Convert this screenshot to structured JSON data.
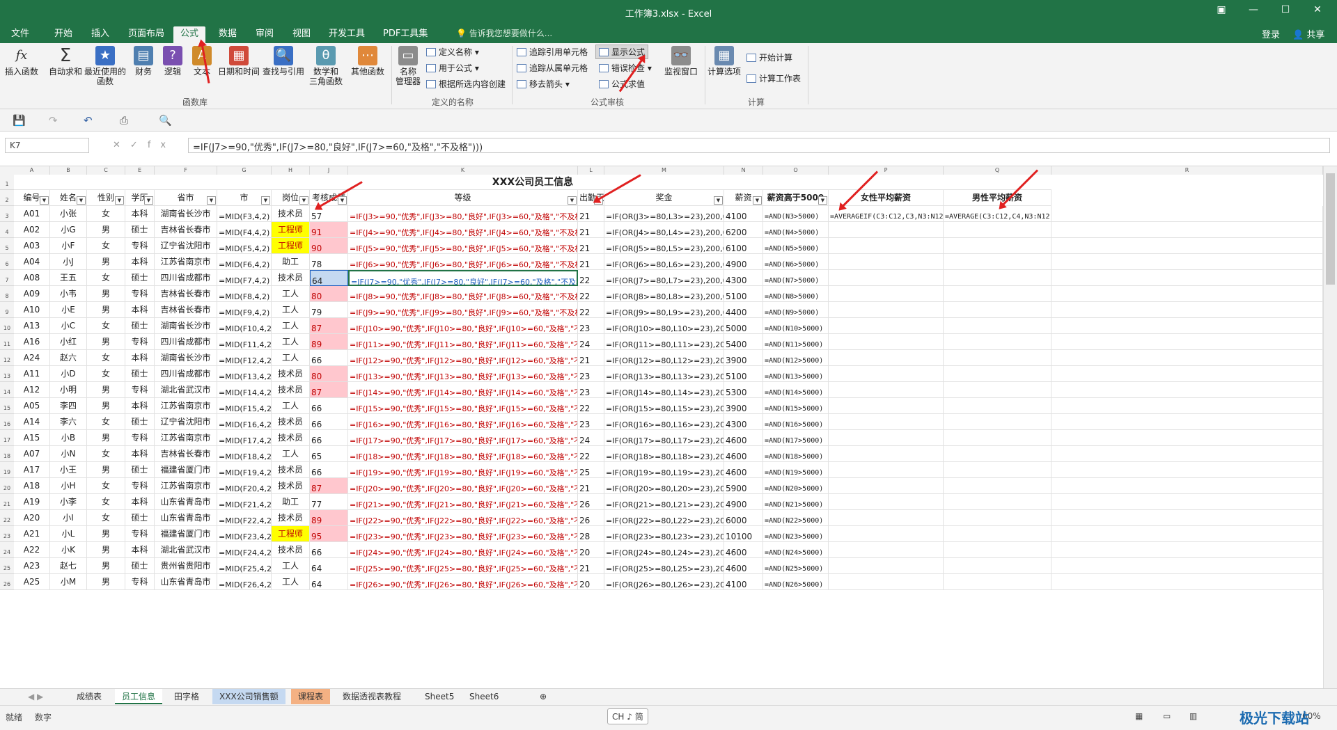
{
  "window": {
    "title": "工作簿3.xlsx - Excel"
  },
  "tabs": [
    "文件",
    "开始",
    "插入",
    "页面布局",
    "公式",
    "数据",
    "审阅",
    "视图",
    "开发工具",
    "PDF工具集"
  ],
  "tellme": "告诉我您想要做什么...",
  "account": {
    "login": "登录",
    "share": "共享"
  },
  "ribbon": {
    "func_lib": [
      "插入函数",
      "自动求和",
      "最近使用的\n函数",
      "财务",
      "逻辑",
      "文本",
      "日期和时间",
      "查找与引用",
      "数学和\n三角函数",
      "其他函数"
    ],
    "func_lib_label": "函数库",
    "names": {
      "manager": "名称\n管理器",
      "define": "定义名称",
      "use": "用于公式",
      "create": "根据所选内容创建",
      "label": "定义的名称"
    },
    "audit": {
      "trace_prec": "追踪引用单元格",
      "trace_dep": "追踪从属单元格",
      "remove": "移去箭头",
      "show": "显示公式",
      "check": "错误检查",
      "eval": "公式求值",
      "watch": "监视窗口",
      "label": "公式审核"
    },
    "calc": {
      "options": "计算选项",
      "now": "开始计算",
      "sheet": "计算工作表",
      "label": "计算"
    }
  },
  "namebox": "K7",
  "formula": "=IF(J7>=90,\"优秀\",IF(J7>=80,\"良好\",IF(J7>=60,\"及格\",\"不及格\")))",
  "columns": [
    "A",
    "B",
    "C",
    "E",
    "F",
    "G",
    "H",
    "J",
    "K",
    "L",
    "M",
    "N",
    "O",
    "P",
    "Q",
    "R"
  ],
  "sheet_title": "XXX公司员工信息",
  "headers": [
    "编号",
    "姓名",
    "性别",
    "学历",
    "省市",
    "市",
    "岗位",
    "考核成绩",
    "等级",
    "出勤天",
    "奖金",
    "薪资",
    "薪资高于5000",
    "女性平均薪资",
    "男性平均薪资"
  ],
  "rows": [
    [
      "A01",
      "小张",
      "女",
      "本科",
      "湖南省长沙市",
      "技术员",
      "57",
      "21",
      "4100"
    ],
    [
      "A02",
      "小G",
      "男",
      "硕士",
      "吉林省长春市",
      "工程师",
      "91",
      "21",
      "6200"
    ],
    [
      "A03",
      "小F",
      "女",
      "专科",
      "辽宁省沈阳市",
      "工程师",
      "90",
      "21",
      "6100"
    ],
    [
      "A04",
      "小J",
      "男",
      "本科",
      "江苏省南京市",
      "助工",
      "78",
      "21",
      "4900"
    ],
    [
      "A08",
      "王五",
      "女",
      "硕士",
      "四川省成都市",
      "技术员",
      "64",
      "22",
      "4300"
    ],
    [
      "A09",
      "小韦",
      "男",
      "专科",
      "吉林省长春市",
      "工人",
      "80",
      "22",
      "5100"
    ],
    [
      "A10",
      "小E",
      "男",
      "本科",
      "吉林省长春市",
      "工人",
      "79",
      "22",
      "4400"
    ],
    [
      "A13",
      "小C",
      "女",
      "硕士",
      "湖南省长沙市",
      "工人",
      "87",
      "23",
      "5000"
    ],
    [
      "A16",
      "小红",
      "男",
      "专科",
      "四川省成都市",
      "工人",
      "89",
      "24",
      "5400"
    ],
    [
      "A24",
      "赵六",
      "女",
      "本科",
      "湖南省长沙市",
      "工人",
      "66",
      "21",
      "3900"
    ],
    [
      "A11",
      "小D",
      "女",
      "硕士",
      "四川省成都市",
      "技术员",
      "80",
      "23",
      "5100"
    ],
    [
      "A12",
      "小明",
      "男",
      "专科",
      "湖北省武汉市",
      "技术员",
      "87",
      "23",
      "5300"
    ],
    [
      "A05",
      "李四",
      "男",
      "本科",
      "江苏省南京市",
      "工人",
      "66",
      "22",
      "3900"
    ],
    [
      "A14",
      "李六",
      "女",
      "硕士",
      "辽宁省沈阳市",
      "技术员",
      "66",
      "23",
      "4300"
    ],
    [
      "A15",
      "小B",
      "男",
      "专科",
      "江苏省南京市",
      "技术员",
      "66",
      "24",
      "4600"
    ],
    [
      "A07",
      "小N",
      "女",
      "本科",
      "吉林省长春市",
      "工人",
      "65",
      "22",
      "4600"
    ],
    [
      "A17",
      "小王",
      "男",
      "硕士",
      "福建省厦门市",
      "技术员",
      "66",
      "25",
      "4600"
    ],
    [
      "A18",
      "小H",
      "女",
      "专科",
      "江苏省南京市",
      "技术员",
      "87",
      "21",
      "5900"
    ],
    [
      "A19",
      "小李",
      "女",
      "本科",
      "山东省青岛市",
      "助工",
      "77",
      "26",
      "4900"
    ],
    [
      "A20",
      "小I",
      "女",
      "硕士",
      "山东省青岛市",
      "技术员",
      "89",
      "26",
      "6000"
    ],
    [
      "A21",
      "小L",
      "男",
      "专科",
      "福建省厦门市",
      "工程师",
      "95",
      "28",
      "10100"
    ],
    [
      "A22",
      "小K",
      "男",
      "本科",
      "湖北省武汉市",
      "技术员",
      "66",
      "20",
      "4600"
    ],
    [
      "A23",
      "赵七",
      "男",
      "硕士",
      "贵州省贵阳市",
      "工人",
      "64",
      "21",
      "4600"
    ],
    [
      "A25",
      "小M",
      "男",
      "专科",
      "山东省青岛市",
      "工人",
      "64",
      "20",
      "4100"
    ]
  ],
  "p3": "=AVERAGEIF(C3:C12,C3,N3:N12)",
  "q3": "=AVERAGE(C3:C12,C4,N3:N12)",
  "sheets": [
    "成绩表",
    "员工信息",
    "田字格",
    "XXX公司销售额",
    "课程表",
    "数据透视表教程",
    "Sheet5",
    "Sheet6"
  ],
  "ime": "CH ♪ 简",
  "status": {
    "ready": "就绪",
    "mode": "数字",
    "zoom": "60%"
  },
  "watermark": "极光下载站",
  "colors": {
    "excel_green": "#217346",
    "pink": "#ffc7ce",
    "yellow": "#ffff00",
    "red_text": "#c00000"
  }
}
